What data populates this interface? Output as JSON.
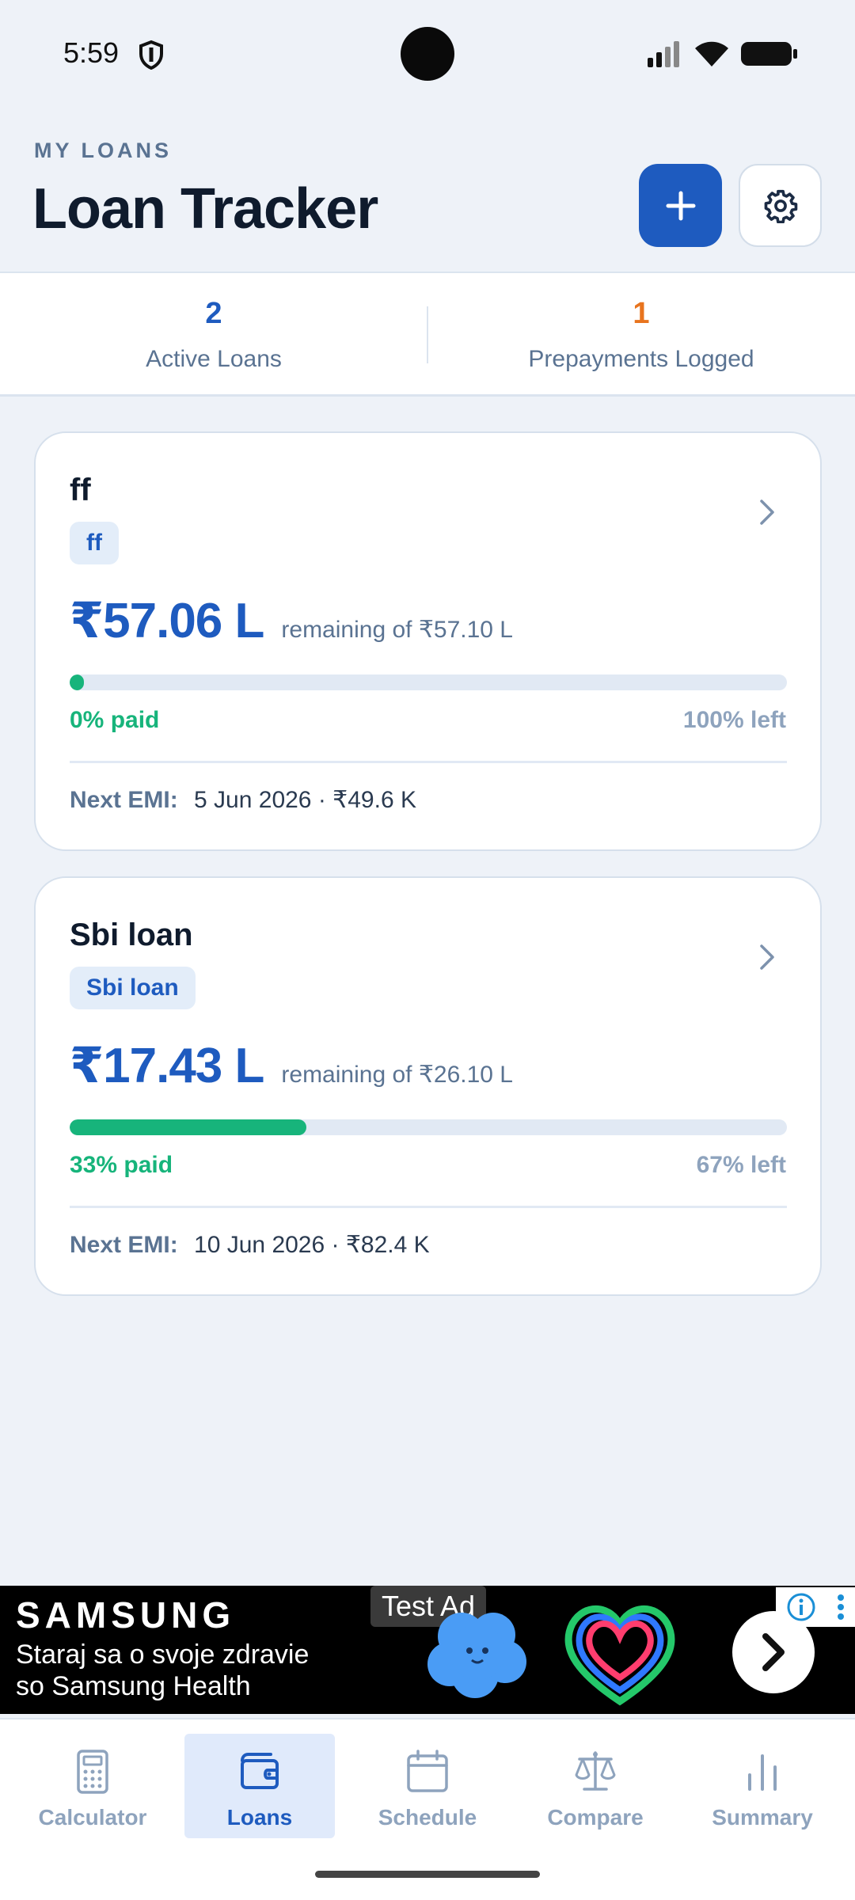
{
  "status": {
    "time": "5:59"
  },
  "header": {
    "eyebrow": "MY LOANS",
    "title": "Loan Tracker"
  },
  "stats": {
    "active_count": "2",
    "active_label": "Active Loans",
    "prepay_count": "1",
    "prepay_label": "Prepayments Logged"
  },
  "loans": [
    {
      "name": "ff",
      "chip": "ff",
      "amount": "₹57.06 L",
      "remaining": "remaining of ₹57.10 L",
      "paid_fraction": 0.0,
      "paid_label": "0% paid",
      "left_label": "100% left",
      "emi_label": "Next EMI:",
      "emi_value": "5 Jun 2026 · ₹49.6 K"
    },
    {
      "name": "Sbi loan",
      "chip": "Sbi loan",
      "amount": "₹17.43 L",
      "remaining": "remaining of ₹26.10 L",
      "paid_fraction": 0.33,
      "paid_label": "33% paid",
      "left_label": "67% left",
      "emi_label": "Next EMI:",
      "emi_value": "10 Jun 2026 · ₹82.4 K"
    }
  ],
  "ad": {
    "tag": "Test Ad",
    "brand": "SAMSUNG",
    "line1": "Staraj sa o svoje zdravie",
    "line2": "so Samsung Health"
  },
  "nav": {
    "items": [
      {
        "label": "Calculator",
        "icon": "calculator-icon"
      },
      {
        "label": "Loans",
        "icon": "wallet-icon"
      },
      {
        "label": "Schedule",
        "icon": "calendar-icon"
      },
      {
        "label": "Compare",
        "icon": "scale-icon"
      },
      {
        "label": "Summary",
        "icon": "bar-chart-icon"
      }
    ],
    "active": "Loans"
  },
  "colors": {
    "primary": "#1e5bbf",
    "success": "#17b47b",
    "accent_orange": "#e8741e",
    "muted": "#5a7392"
  }
}
